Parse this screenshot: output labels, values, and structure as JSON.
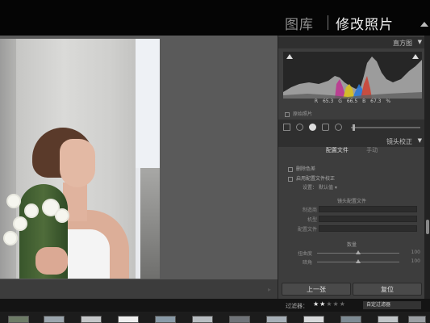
{
  "modules": {
    "library": "图库",
    "develop": "修改照片"
  },
  "histogram": {
    "title": "直方图",
    "readout": {
      "r_label": "R",
      "r_value": "65.3",
      "g_label": "G",
      "g_value": "66.5",
      "b_label": "B",
      "b_value": "67.3",
      "unit": "%"
    },
    "original_label": "原始照片"
  },
  "lens_panel": {
    "title": "镜头校正",
    "tabs": [
      "配置文件",
      "手动"
    ],
    "options": [
      "删除色差",
      "启用配置文件校正"
    ],
    "setup_label": "设置",
    "setup_value": "默认值",
    "lens_profile_title": "镜头配置文件",
    "fields": [
      "制造商",
      "机型",
      "配置文件"
    ],
    "amount_title": "数量",
    "sliders": [
      {
        "label": "扭曲度",
        "value": "100"
      },
      {
        "label": "暗角",
        "value": "100"
      }
    ]
  },
  "buttons": {
    "previous": "上一张",
    "reset": "复位"
  },
  "filmstrip": {
    "filter_label": "过滤器：",
    "rating": {
      "filled": 2,
      "total": 5
    },
    "filter_value": "自定过滤器"
  },
  "colors": {
    "panel_bg": "#3d3d3d",
    "workspace_bg": "#5a5a5a",
    "active_module": "#ececec",
    "inactive_module": "#8f8f8f"
  }
}
